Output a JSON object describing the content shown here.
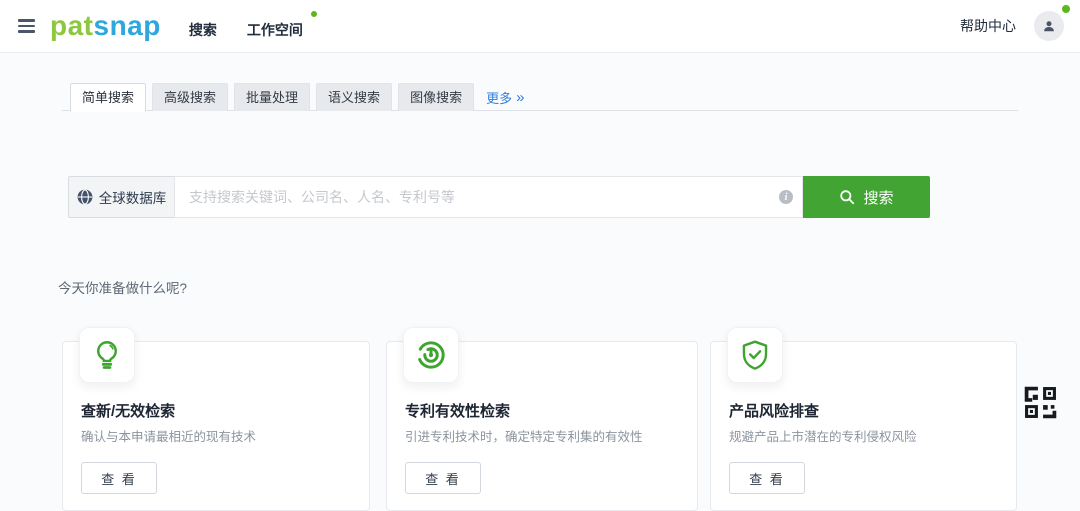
{
  "header": {
    "logo_part1": "pat",
    "logo_part2": "snap",
    "nav_search": "搜索",
    "nav_workspace": "工作空间",
    "help_center": "帮助中心"
  },
  "tabs": {
    "items": [
      {
        "label": "简单搜索",
        "active": true
      },
      {
        "label": "高级搜索",
        "active": false
      },
      {
        "label": "批量处理",
        "active": false
      },
      {
        "label": "语义搜索",
        "active": false
      },
      {
        "label": "图像搜索",
        "active": false
      }
    ],
    "more_label": "更多",
    "more_chevron": "»"
  },
  "search": {
    "scope_label": "全球数据库",
    "placeholder": "支持搜索关键词、公司名、人名、专利号等",
    "info_glyph": "i",
    "button_label": "搜索"
  },
  "intro_text": "今天你准备做什么呢?",
  "cards": [
    {
      "icon": "lightbulb-icon",
      "title": "查新/无效检索",
      "desc": "确认与本申请最相近的现有技术",
      "button_label": "查 看"
    },
    {
      "icon": "target-icon",
      "title": "专利有效性检索",
      "desc": "引进专利技术时，确定特定专利集的有效性",
      "button_label": "查 看"
    },
    {
      "icon": "shield-check-icon",
      "title": "产品风险排查",
      "desc": "规避产品上市潜在的专利侵权风险",
      "button_label": "查 看"
    }
  ],
  "colors": {
    "logo_green": "#8dc63f",
    "logo_blue": "#2ea7dd",
    "accent_green": "#41a433",
    "icon_green": "#3ea42f",
    "badge_green": "#5ab71f",
    "link_blue": "#2f7fe0",
    "qr_black": "#171a1e"
  }
}
